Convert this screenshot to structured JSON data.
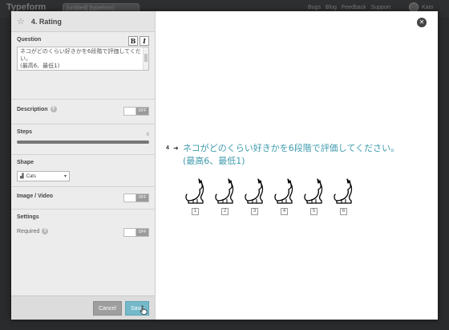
{
  "app": {
    "logo": "Typeform",
    "tab_label": "[untitled] [typeform]",
    "top_links": [
      "Bugs",
      "Blog",
      "Feedback",
      "Support"
    ],
    "user_name": "Kato"
  },
  "panel": {
    "title": "4. Rating",
    "question_label": "Question",
    "bold_label": "B",
    "italic_label": "I",
    "question_lines": [
      "ネコがどのくらい好きかを6段階で評価してくださ",
      "い。",
      "(最高6、最低1)"
    ],
    "description_label": "Description",
    "description_toggle": "OFF",
    "steps_label": "Steps",
    "steps_value": "6",
    "shape_label": "Shape",
    "shape_value": "Cats",
    "image_video_label": "Image / Video",
    "image_video_toggle": "OFF",
    "settings_label": "Settings",
    "required_label": "Required",
    "required_toggle": "OFF",
    "cancel_label": "Cancel",
    "save_label": "Save"
  },
  "preview": {
    "question_number": "4",
    "question_line1": "ネコがどのくらい好きかを6段階で評価してください。",
    "question_line2": "(最高6、最低1)",
    "rating_labels": [
      "1",
      "2",
      "3",
      "4",
      "5",
      "6"
    ]
  },
  "colors": {
    "accent": "#3f9bae",
    "save_button": "#73b9c9",
    "backdrop": "#2a2b2c"
  },
  "icons": {
    "star": "star-icon",
    "help": "help-icon",
    "close": "close-icon",
    "shape": "cat-icon"
  }
}
